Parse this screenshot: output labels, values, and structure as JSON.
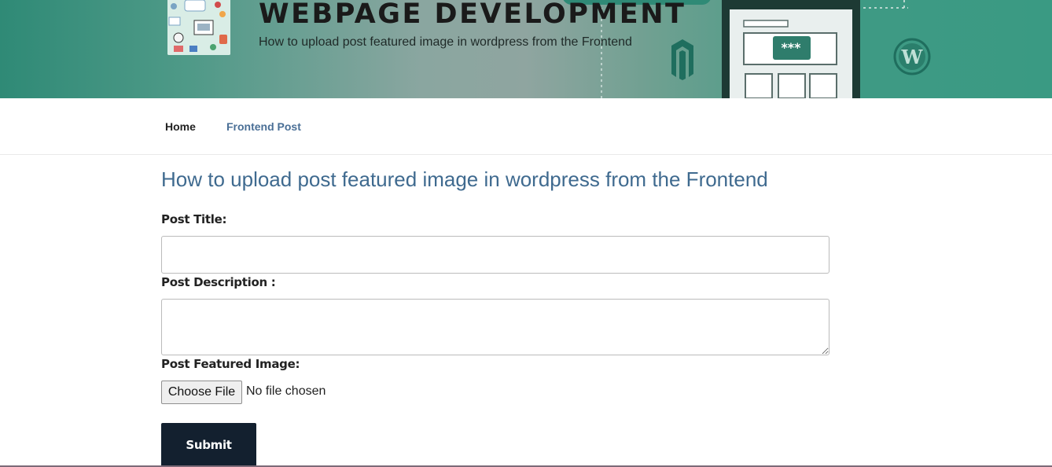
{
  "header": {
    "site_title": "WEBPAGE DEVELOPMENT",
    "site_description": "How to upload post featured image in wordpress from the Frontend",
    "colors": {
      "banner_teal": "#2f8a76",
      "title_text": "#1a1a1a"
    }
  },
  "nav": {
    "items": [
      {
        "label": "Home"
      },
      {
        "label": "Frontend Post"
      }
    ],
    "colors": {
      "active": "#222222",
      "link": "#4a6f96"
    }
  },
  "main": {
    "heading": "How to upload post featured image in wordpress from the Frontend",
    "form": {
      "post_title_label": "Post Title:",
      "post_title_value": "",
      "post_description_label": "Post Description :",
      "post_description_value": "",
      "featured_image_label": "Post Featured Image:",
      "choose_file_label": "Choose File",
      "file_status": "No file chosen",
      "submit_label": "Submit"
    },
    "colors": {
      "heading": "#3f6a8f",
      "submit_bg": "#13202f"
    }
  }
}
